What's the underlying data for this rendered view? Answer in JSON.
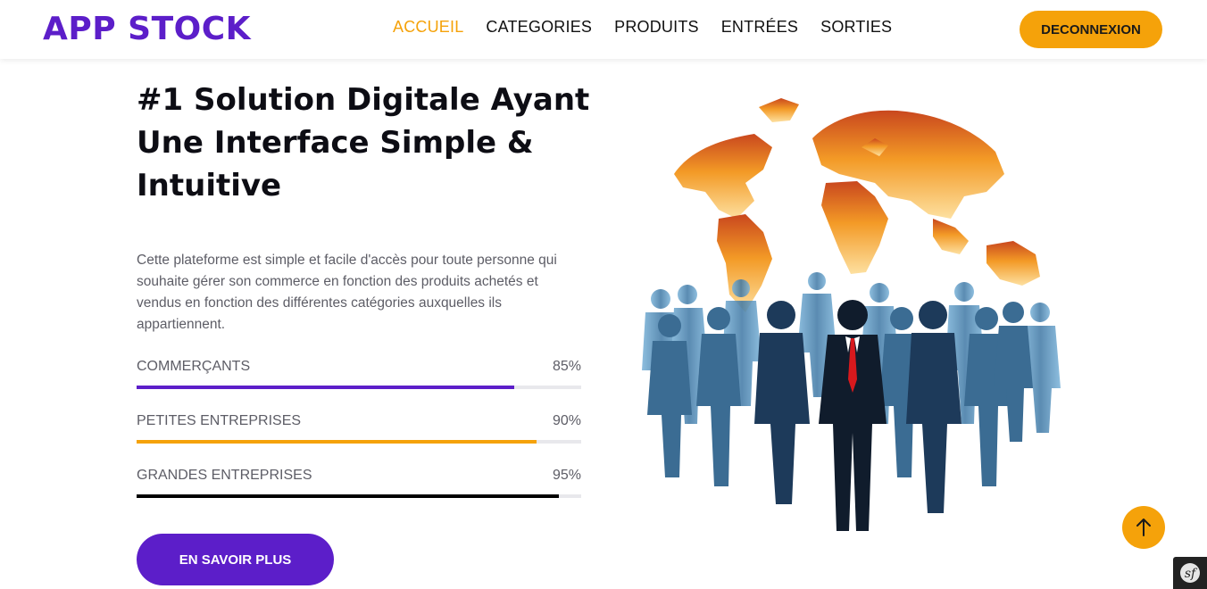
{
  "brand": {
    "name": "APP STOCK",
    "color": "#5c1ec9"
  },
  "nav": {
    "items": [
      {
        "label": "ACCUEIL",
        "active": true
      },
      {
        "label": "CATEGORIES",
        "active": false
      },
      {
        "label": "PRODUITS",
        "active": false
      },
      {
        "label": "ENTRÉES",
        "active": false
      },
      {
        "label": "SORTIES",
        "active": false
      }
    ],
    "logout_label": "DECONNEXION"
  },
  "hero": {
    "title": "#1 Solution Digitale Ayant Une Interface Simple & Intuitive",
    "description": "Cette plateforme est simple et facile d'accès pour toute personne qui souhaite gérer son commerce en fonction des produits achetés et vendus en fonction des différentes catégories auxquelles ils appartiennent.",
    "cta_label": "EN SAVOIR PLUS"
  },
  "skills": [
    {
      "label": "COMMERÇANTS",
      "percent_text": "85%",
      "percent": 85,
      "color": "#5c1ec9"
    },
    {
      "label": "PETITES ENTREPRISES",
      "percent_text": "90%",
      "percent": 90,
      "color": "#f5a20a"
    },
    {
      "label": "GRANDES ENTREPRISES",
      "percent_text": "95%",
      "percent": 95,
      "color": "#000000"
    }
  ],
  "icons": {
    "scroll_top": "arrow-up-icon",
    "debug_toolbar": "symfony-icon",
    "illustration": "globe-business-people"
  },
  "colors": {
    "accent": "#f5a20a",
    "primary": "#5c1ec9",
    "text": "#0d0d14",
    "muted": "#5d5d66"
  }
}
